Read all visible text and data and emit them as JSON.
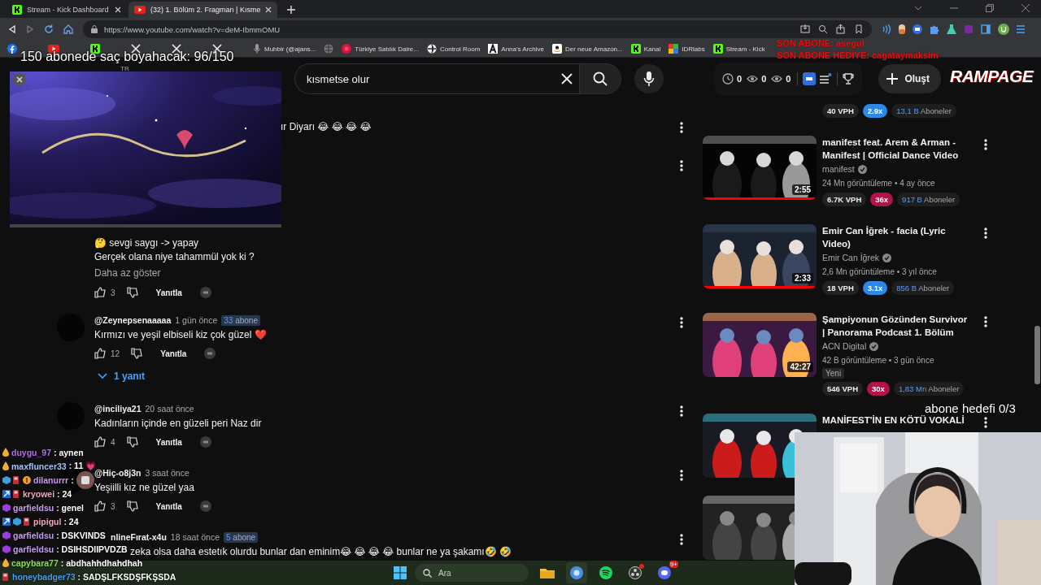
{
  "browser": {
    "tabs": [
      {
        "title": "Stream - Kick Dashboard",
        "kind": "kick",
        "selected": false
      },
      {
        "title": "(32) 1. Bölüm 2. Fragman | Kısme",
        "kind": "youtube",
        "selected": true
      }
    ],
    "address": "https://www.youtube.com/watch?v=deM-IbmmOMU",
    "bookmarks": [
      {
        "kind": "facebook"
      },
      {
        "kind": "youtube"
      },
      {
        "kind": "kick"
      },
      {
        "kind": "x"
      },
      {
        "kind": "x"
      },
      {
        "kind": "x"
      },
      {
        "label": "Muhbir (@ajans...",
        "kind": "mic"
      },
      {
        "kind": "globe"
      },
      {
        "label": "Türkiye Satılık Daire...",
        "kind": "red"
      },
      {
        "label": "Control Room",
        "kind": "aperture"
      },
      {
        "label": "Anna's Archive",
        "kind": "letter"
      },
      {
        "label": "Der neue Amazon...",
        "kind": "amazon"
      },
      {
        "label": "Kanal",
        "kind": "kick"
      },
      {
        "label": "IDRlabs",
        "kind": "grid"
      },
      {
        "label": "Stream - Kick",
        "kind": "kick"
      }
    ]
  },
  "header": {
    "region": "TR",
    "search": {
      "value": "kısmetse olur"
    },
    "stats": [
      {
        "kind": "clock",
        "value": "0"
      },
      {
        "kind": "eye",
        "value": "0"
      },
      {
        "kind": "eye",
        "value": "0"
      }
    ],
    "create_label": "Oluşt"
  },
  "comments": [
    {
      "kind": "tail",
      "text": "ır Diyarı 😂 😂 😂 😂"
    },
    {
      "kind": "expanded",
      "lines": [
        "🤔 sevgi saygı  -> yapay",
        "Gerçek olana niye tahammül yok ki ?"
      ],
      "collapse": "Daha az göster",
      "likes": "3",
      "reply_label": "Yanıtla"
    },
    {
      "kind": "full",
      "author": "@Zeynepsenaaaaa",
      "time": "1 gün önce",
      "subs_count": "33",
      "subs_label": "abone",
      "text": "Kırmızı ve yeşil elbiseli kiz çok güzel ❤️",
      "likes": "12",
      "reply_label": "Yanıtla",
      "replies": "1 yanıt"
    },
    {
      "kind": "full",
      "author": "@inciliya21",
      "time": "20 saat önce",
      "text": "Kadınların içinde en güzeli peri Naz dir",
      "likes": "4",
      "reply_label": "Yanıtla"
    },
    {
      "kind": "full",
      "author": "@Hiç-o8j3n",
      "time": "3 saat önce",
      "text": "Yeşiilli kız ne güzel yaa",
      "likes": "3",
      "reply_label": "Yanıtla"
    },
    {
      "kind": "covered",
      "author": "nlineFırat-x4u",
      "time": "18 saat önce",
      "subs_count": "5",
      "subs_label": "abone",
      "text": "zeka olsa daha estetık olurdu bunlar dan eminim😂 😂 😂 😂 bunlar ne ya şakamı🤣 🤣"
    }
  ],
  "related": [
    {
      "kind": "stats-only",
      "vph": "40 VPH",
      "multiplier": "2.9x",
      "color": "#2b8ae8",
      "subs_count": "13,1 B",
      "subs_label": "Aboneler"
    },
    {
      "kind": "video",
      "title": "manifest feat. Arem & Arman  - Manifest | Official Dance Video",
      "channel": "manifest",
      "meta": "24 Mn görüntüleme • 4 ay önce",
      "duration": "2:55",
      "level": 1,
      "vph": "6.7K VPH",
      "multiplier": "36x",
      "color": "#b3124a",
      "subs_count": "917 B",
      "subs_label": "Aboneler"
    },
    {
      "kind": "video",
      "title": "Emir Can İğrek - facia (Lyric Video)",
      "channel": "Emir Can İğrek",
      "meta": "2,6 Mn görüntüleme • 3 yıl önce",
      "duration": "2:33",
      "level": 1,
      "vph": "18 VPH",
      "multiplier": "3.1x",
      "color": "#2b8ae8",
      "subs_count": "856 B",
      "subs_label": "Aboneler"
    },
    {
      "kind": "video",
      "title": "Şampiyonun Gözünden Survivor | Panorama Podcast 1. Bölüm",
      "channel": "ACN Digital",
      "meta": "42 B görüntüleme • 3 gün önce",
      "tag": "Yeni",
      "duration": "42:27",
      "vph": "546 VPH",
      "multiplier": "30x",
      "color": "#b3124a",
      "subs_count": "1,83 Mn",
      "subs_label": "Aboneler"
    },
    {
      "kind": "video",
      "title": "MANİFEST'İN EN KÖTÜ VOKALİ"
    },
    {
      "kind": "video"
    }
  ],
  "overlay": {
    "goal": "150 abonede saç boyahacak: 96/150",
    "last_sub": "SON ABONE: asegul",
    "last_gift": "SON ABONE HEDİYE: cagataymaksim",
    "logo": "RAMPAGE",
    "sub_goal": "abone hedefi 0/3",
    "chat": [
      {
        "user": "duygu_97",
        "message": ": aynen",
        "color": "#b36cf0",
        "badges": [
          {
            "kind": "drop"
          }
        ]
      },
      {
        "user": "maxfluncer33",
        "message": ": 11 💗",
        "color": "#9fc4f5",
        "badges": [
          {
            "kind": "drop"
          }
        ]
      },
      {
        "user": "dilanurrr",
        "message": ":",
        "emote": true,
        "color": "#c89cf5",
        "badges": [
          {
            "kind": "cube"
          },
          {
            "kind": "gas"
          },
          {
            "kind": "coin"
          }
        ]
      },
      {
        "user": "kryowei",
        "message": ": 24",
        "color": "#f5a3c0",
        "badges": [
          {
            "kind": "boost"
          },
          {
            "kind": "gas"
          }
        ]
      },
      {
        "user": "garfieldsu",
        "message": ": genel",
        "color": "#c89cf5",
        "badges": [
          {
            "kind": "gem"
          }
        ]
      },
      {
        "user": "pipigul",
        "message": ": 24",
        "color": "#f5a3c0",
        "badges": [
          {
            "kind": "boost"
          },
          {
            "kind": "cube"
          },
          {
            "kind": "gas"
          }
        ]
      },
      {
        "user": "garfieldsu",
        "message": ": DSKVINDS",
        "color": "#c89cf5",
        "badges": [
          {
            "kind": "gem"
          }
        ]
      },
      {
        "user": "garfieldsu",
        "message": ": DSIHSDIIPVDZB",
        "color": "#c89cf5",
        "badges": [
          {
            "kind": "gem"
          }
        ]
      },
      {
        "user": "capybara77",
        "message": ": abdhahhdhahdhah",
        "color": "#8be04e",
        "badges": [
          {
            "kind": "drop"
          }
        ]
      },
      {
        "user": "honeybadger73",
        "message": ": SADŞLFKSDŞFKŞSDA",
        "color": "#4b9bf0",
        "badges": [
          {
            "kind": "gas"
          }
        ]
      }
    ]
  },
  "taskbar": {
    "search_placeholder": "Ara",
    "apps": [
      {
        "kind": "folder"
      },
      {
        "kind": "chrome",
        "selected": true
      },
      {
        "kind": "spotify"
      },
      {
        "kind": "obs",
        "alert": true
      },
      {
        "kind": "discord",
        "badge": "9+"
      }
    ]
  }
}
